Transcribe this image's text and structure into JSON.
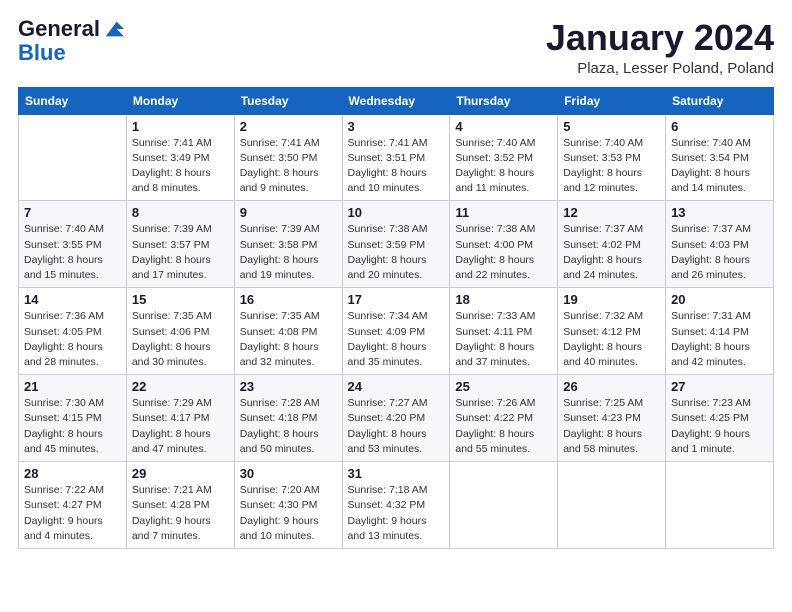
{
  "header": {
    "logo_general": "General",
    "logo_blue": "Blue",
    "month_title": "January 2024",
    "location": "Plaza, Lesser Poland, Poland"
  },
  "weekdays": [
    "Sunday",
    "Monday",
    "Tuesday",
    "Wednesday",
    "Thursday",
    "Friday",
    "Saturday"
  ],
  "weeks": [
    [
      {
        "day": "",
        "info": ""
      },
      {
        "day": "1",
        "info": "Sunrise: 7:41 AM\nSunset: 3:49 PM\nDaylight: 8 hours\nand 8 minutes."
      },
      {
        "day": "2",
        "info": "Sunrise: 7:41 AM\nSunset: 3:50 PM\nDaylight: 8 hours\nand 9 minutes."
      },
      {
        "day": "3",
        "info": "Sunrise: 7:41 AM\nSunset: 3:51 PM\nDaylight: 8 hours\nand 10 minutes."
      },
      {
        "day": "4",
        "info": "Sunrise: 7:40 AM\nSunset: 3:52 PM\nDaylight: 8 hours\nand 11 minutes."
      },
      {
        "day": "5",
        "info": "Sunrise: 7:40 AM\nSunset: 3:53 PM\nDaylight: 8 hours\nand 12 minutes."
      },
      {
        "day": "6",
        "info": "Sunrise: 7:40 AM\nSunset: 3:54 PM\nDaylight: 8 hours\nand 14 minutes."
      }
    ],
    [
      {
        "day": "7",
        "info": "Sunrise: 7:40 AM\nSunset: 3:55 PM\nDaylight: 8 hours\nand 15 minutes."
      },
      {
        "day": "8",
        "info": "Sunrise: 7:39 AM\nSunset: 3:57 PM\nDaylight: 8 hours\nand 17 minutes."
      },
      {
        "day": "9",
        "info": "Sunrise: 7:39 AM\nSunset: 3:58 PM\nDaylight: 8 hours\nand 19 minutes."
      },
      {
        "day": "10",
        "info": "Sunrise: 7:38 AM\nSunset: 3:59 PM\nDaylight: 8 hours\nand 20 minutes."
      },
      {
        "day": "11",
        "info": "Sunrise: 7:38 AM\nSunset: 4:00 PM\nDaylight: 8 hours\nand 22 minutes."
      },
      {
        "day": "12",
        "info": "Sunrise: 7:37 AM\nSunset: 4:02 PM\nDaylight: 8 hours\nand 24 minutes."
      },
      {
        "day": "13",
        "info": "Sunrise: 7:37 AM\nSunset: 4:03 PM\nDaylight: 8 hours\nand 26 minutes."
      }
    ],
    [
      {
        "day": "14",
        "info": "Sunrise: 7:36 AM\nSunset: 4:05 PM\nDaylight: 8 hours\nand 28 minutes."
      },
      {
        "day": "15",
        "info": "Sunrise: 7:35 AM\nSunset: 4:06 PM\nDaylight: 8 hours\nand 30 minutes."
      },
      {
        "day": "16",
        "info": "Sunrise: 7:35 AM\nSunset: 4:08 PM\nDaylight: 8 hours\nand 32 minutes."
      },
      {
        "day": "17",
        "info": "Sunrise: 7:34 AM\nSunset: 4:09 PM\nDaylight: 8 hours\nand 35 minutes."
      },
      {
        "day": "18",
        "info": "Sunrise: 7:33 AM\nSunset: 4:11 PM\nDaylight: 8 hours\nand 37 minutes."
      },
      {
        "day": "19",
        "info": "Sunrise: 7:32 AM\nSunset: 4:12 PM\nDaylight: 8 hours\nand 40 minutes."
      },
      {
        "day": "20",
        "info": "Sunrise: 7:31 AM\nSunset: 4:14 PM\nDaylight: 8 hours\nand 42 minutes."
      }
    ],
    [
      {
        "day": "21",
        "info": "Sunrise: 7:30 AM\nSunset: 4:15 PM\nDaylight: 8 hours\nand 45 minutes."
      },
      {
        "day": "22",
        "info": "Sunrise: 7:29 AM\nSunset: 4:17 PM\nDaylight: 8 hours\nand 47 minutes."
      },
      {
        "day": "23",
        "info": "Sunrise: 7:28 AM\nSunset: 4:18 PM\nDaylight: 8 hours\nand 50 minutes."
      },
      {
        "day": "24",
        "info": "Sunrise: 7:27 AM\nSunset: 4:20 PM\nDaylight: 8 hours\nand 53 minutes."
      },
      {
        "day": "25",
        "info": "Sunrise: 7:26 AM\nSunset: 4:22 PM\nDaylight: 8 hours\nand 55 minutes."
      },
      {
        "day": "26",
        "info": "Sunrise: 7:25 AM\nSunset: 4:23 PM\nDaylight: 8 hours\nand 58 minutes."
      },
      {
        "day": "27",
        "info": "Sunrise: 7:23 AM\nSunset: 4:25 PM\nDaylight: 9 hours\nand 1 minute."
      }
    ],
    [
      {
        "day": "28",
        "info": "Sunrise: 7:22 AM\nSunset: 4:27 PM\nDaylight: 9 hours\nand 4 minutes."
      },
      {
        "day": "29",
        "info": "Sunrise: 7:21 AM\nSunset: 4:28 PM\nDaylight: 9 hours\nand 7 minutes."
      },
      {
        "day": "30",
        "info": "Sunrise: 7:20 AM\nSunset: 4:30 PM\nDaylight: 9 hours\nand 10 minutes."
      },
      {
        "day": "31",
        "info": "Sunrise: 7:18 AM\nSunset: 4:32 PM\nDaylight: 9 hours\nand 13 minutes."
      },
      {
        "day": "",
        "info": ""
      },
      {
        "day": "",
        "info": ""
      },
      {
        "day": "",
        "info": ""
      }
    ]
  ]
}
